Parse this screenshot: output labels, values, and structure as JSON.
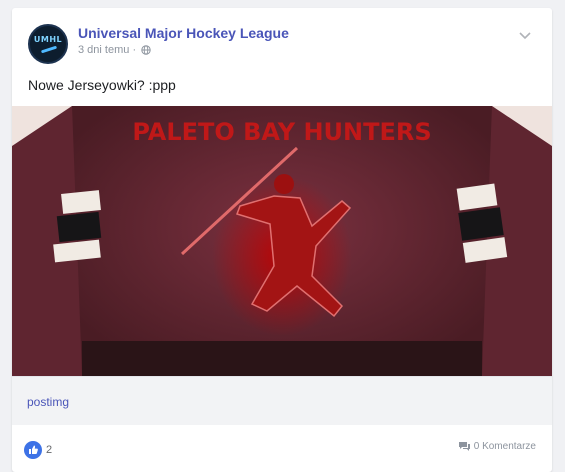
{
  "post": {
    "page_name": "Universal Major Hockey League",
    "avatar_text": "UMHL",
    "timestamp": "3 dni temu",
    "separator": "·",
    "text": "Nowe Jerseyowki? :ppp",
    "image_caption": "PALETO BAY HUNTERS",
    "link_label": "postimg",
    "like_count": "2",
    "comments_label": "0 Komentarze"
  },
  "colors": {
    "accent": "#4a55b8",
    "jersey": "#6b2a33",
    "like_blue": "#3d72e6"
  },
  "icons": {
    "audience": "globe-icon",
    "menu": "chevron-down-icon",
    "like": "thumbs-up-icon",
    "comments": "comments-icon"
  }
}
